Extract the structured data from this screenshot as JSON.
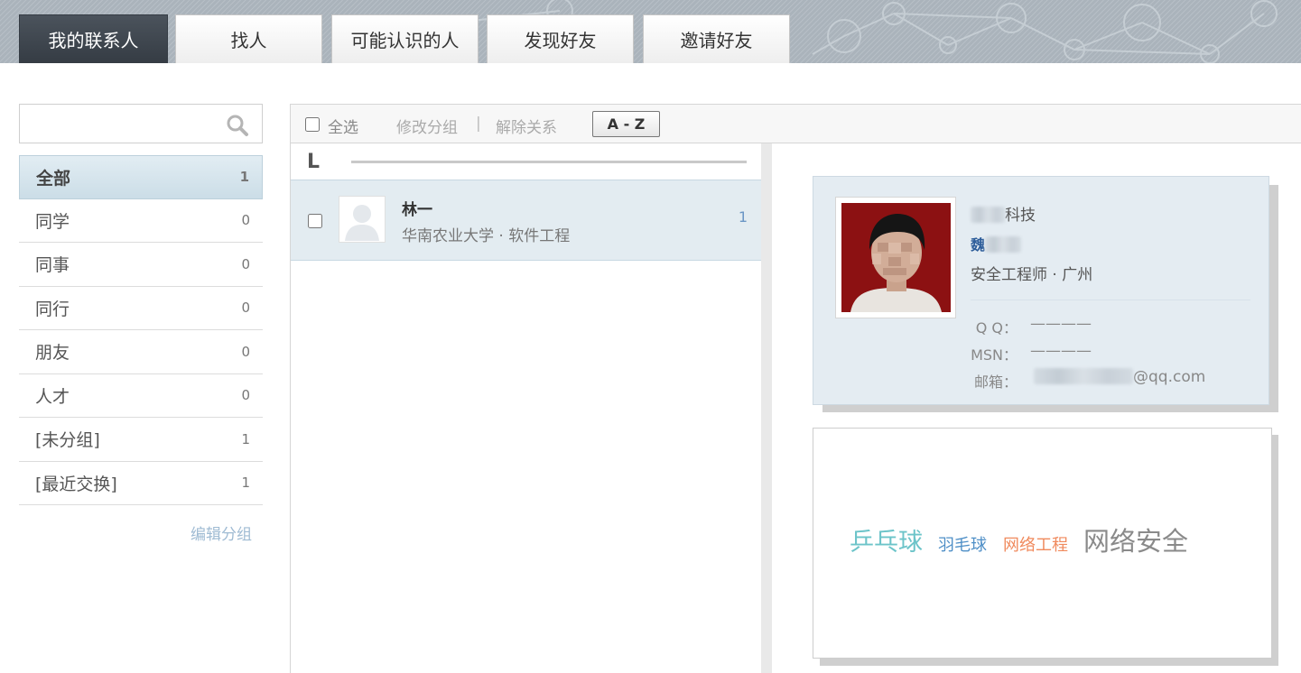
{
  "tabs": [
    {
      "label": "我的联系人"
    },
    {
      "label": "找人"
    },
    {
      "label": "可能认识的人"
    },
    {
      "label": "发现好友"
    },
    {
      "label": "邀请好友"
    }
  ],
  "search": {
    "placeholder": "",
    "value": ""
  },
  "groups": [
    {
      "label": "全部",
      "count": "1"
    },
    {
      "label": "同学",
      "count": "0"
    },
    {
      "label": "同事",
      "count": "0"
    },
    {
      "label": "同行",
      "count": "0"
    },
    {
      "label": "朋友",
      "count": "0"
    },
    {
      "label": "人才",
      "count": "0"
    },
    {
      "label": "[未分组]",
      "count": "1"
    },
    {
      "label": "[最近交换]",
      "count": "1"
    }
  ],
  "edit_groups_label": "编辑分组",
  "toolbar": {
    "select_all": "全选",
    "modify_group": "修改分组",
    "separator": "|",
    "remove_relation": "解除关系",
    "sort_az": "A - Z"
  },
  "list": {
    "letter": "L",
    "contacts": [
      {
        "name": "林一",
        "info": "华南农业大学 · 软件工程",
        "count": "1"
      }
    ]
  },
  "card": {
    "company_suffix": "科技",
    "name_visible": "魏",
    "job": "安全工程师 · 广州",
    "qq_label": "Q Q：",
    "qq_value": "————",
    "msn_label": "MSN：",
    "msn_value": "————",
    "email_label": "邮箱：",
    "email_suffix": "@qq.com"
  },
  "tags": [
    {
      "label": "乒乓球",
      "color": "#6cc4c9"
    },
    {
      "label": "羽毛球",
      "color": "#4f8fc7"
    },
    {
      "label": "网络工程",
      "color": "#f08a5d"
    },
    {
      "label": "网络安全",
      "color": "#8a8a8a"
    }
  ],
  "colors": {
    "active_tab_bg": "#3d444c",
    "link": "#2d5d9a",
    "active_group_bg": "#d3e3ec"
  }
}
